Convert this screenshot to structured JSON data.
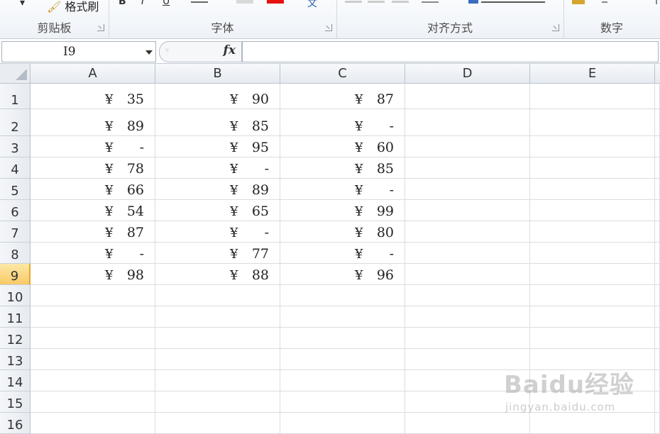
{
  "ribbon": {
    "format_painter_label": "格式刷",
    "groups": {
      "clipboard": "剪贴板",
      "font": "字体",
      "alignment": "对齐方式",
      "number": "数字"
    },
    "font_color": "#e81010",
    "fill_color": "#d9d9d9"
  },
  "formula_bar": {
    "name_box": "I9",
    "fx_label": "fx",
    "formula": ""
  },
  "columns": [
    "A",
    "B",
    "C",
    "D",
    "E"
  ],
  "rows": [
    "1",
    "2",
    "3",
    "4",
    "5",
    "6",
    "7",
    "8",
    "9",
    "10",
    "11",
    "12",
    "13",
    "14",
    "15",
    "16"
  ],
  "active_row": "9",
  "currency_symbol": "¥",
  "cells": {
    "A": [
      "35",
      "89",
      "-",
      "78",
      "66",
      "54",
      "87",
      "-",
      "98"
    ],
    "B": [
      "90",
      "85",
      "95",
      "-",
      "89",
      "65",
      "-",
      "77",
      "88"
    ],
    "C": [
      "87",
      "-",
      "60",
      "85",
      "-",
      "99",
      "80",
      "-",
      "96"
    ]
  },
  "watermark": {
    "brand": "Baidu经验",
    "url": "jingyan.baidu.com"
  }
}
